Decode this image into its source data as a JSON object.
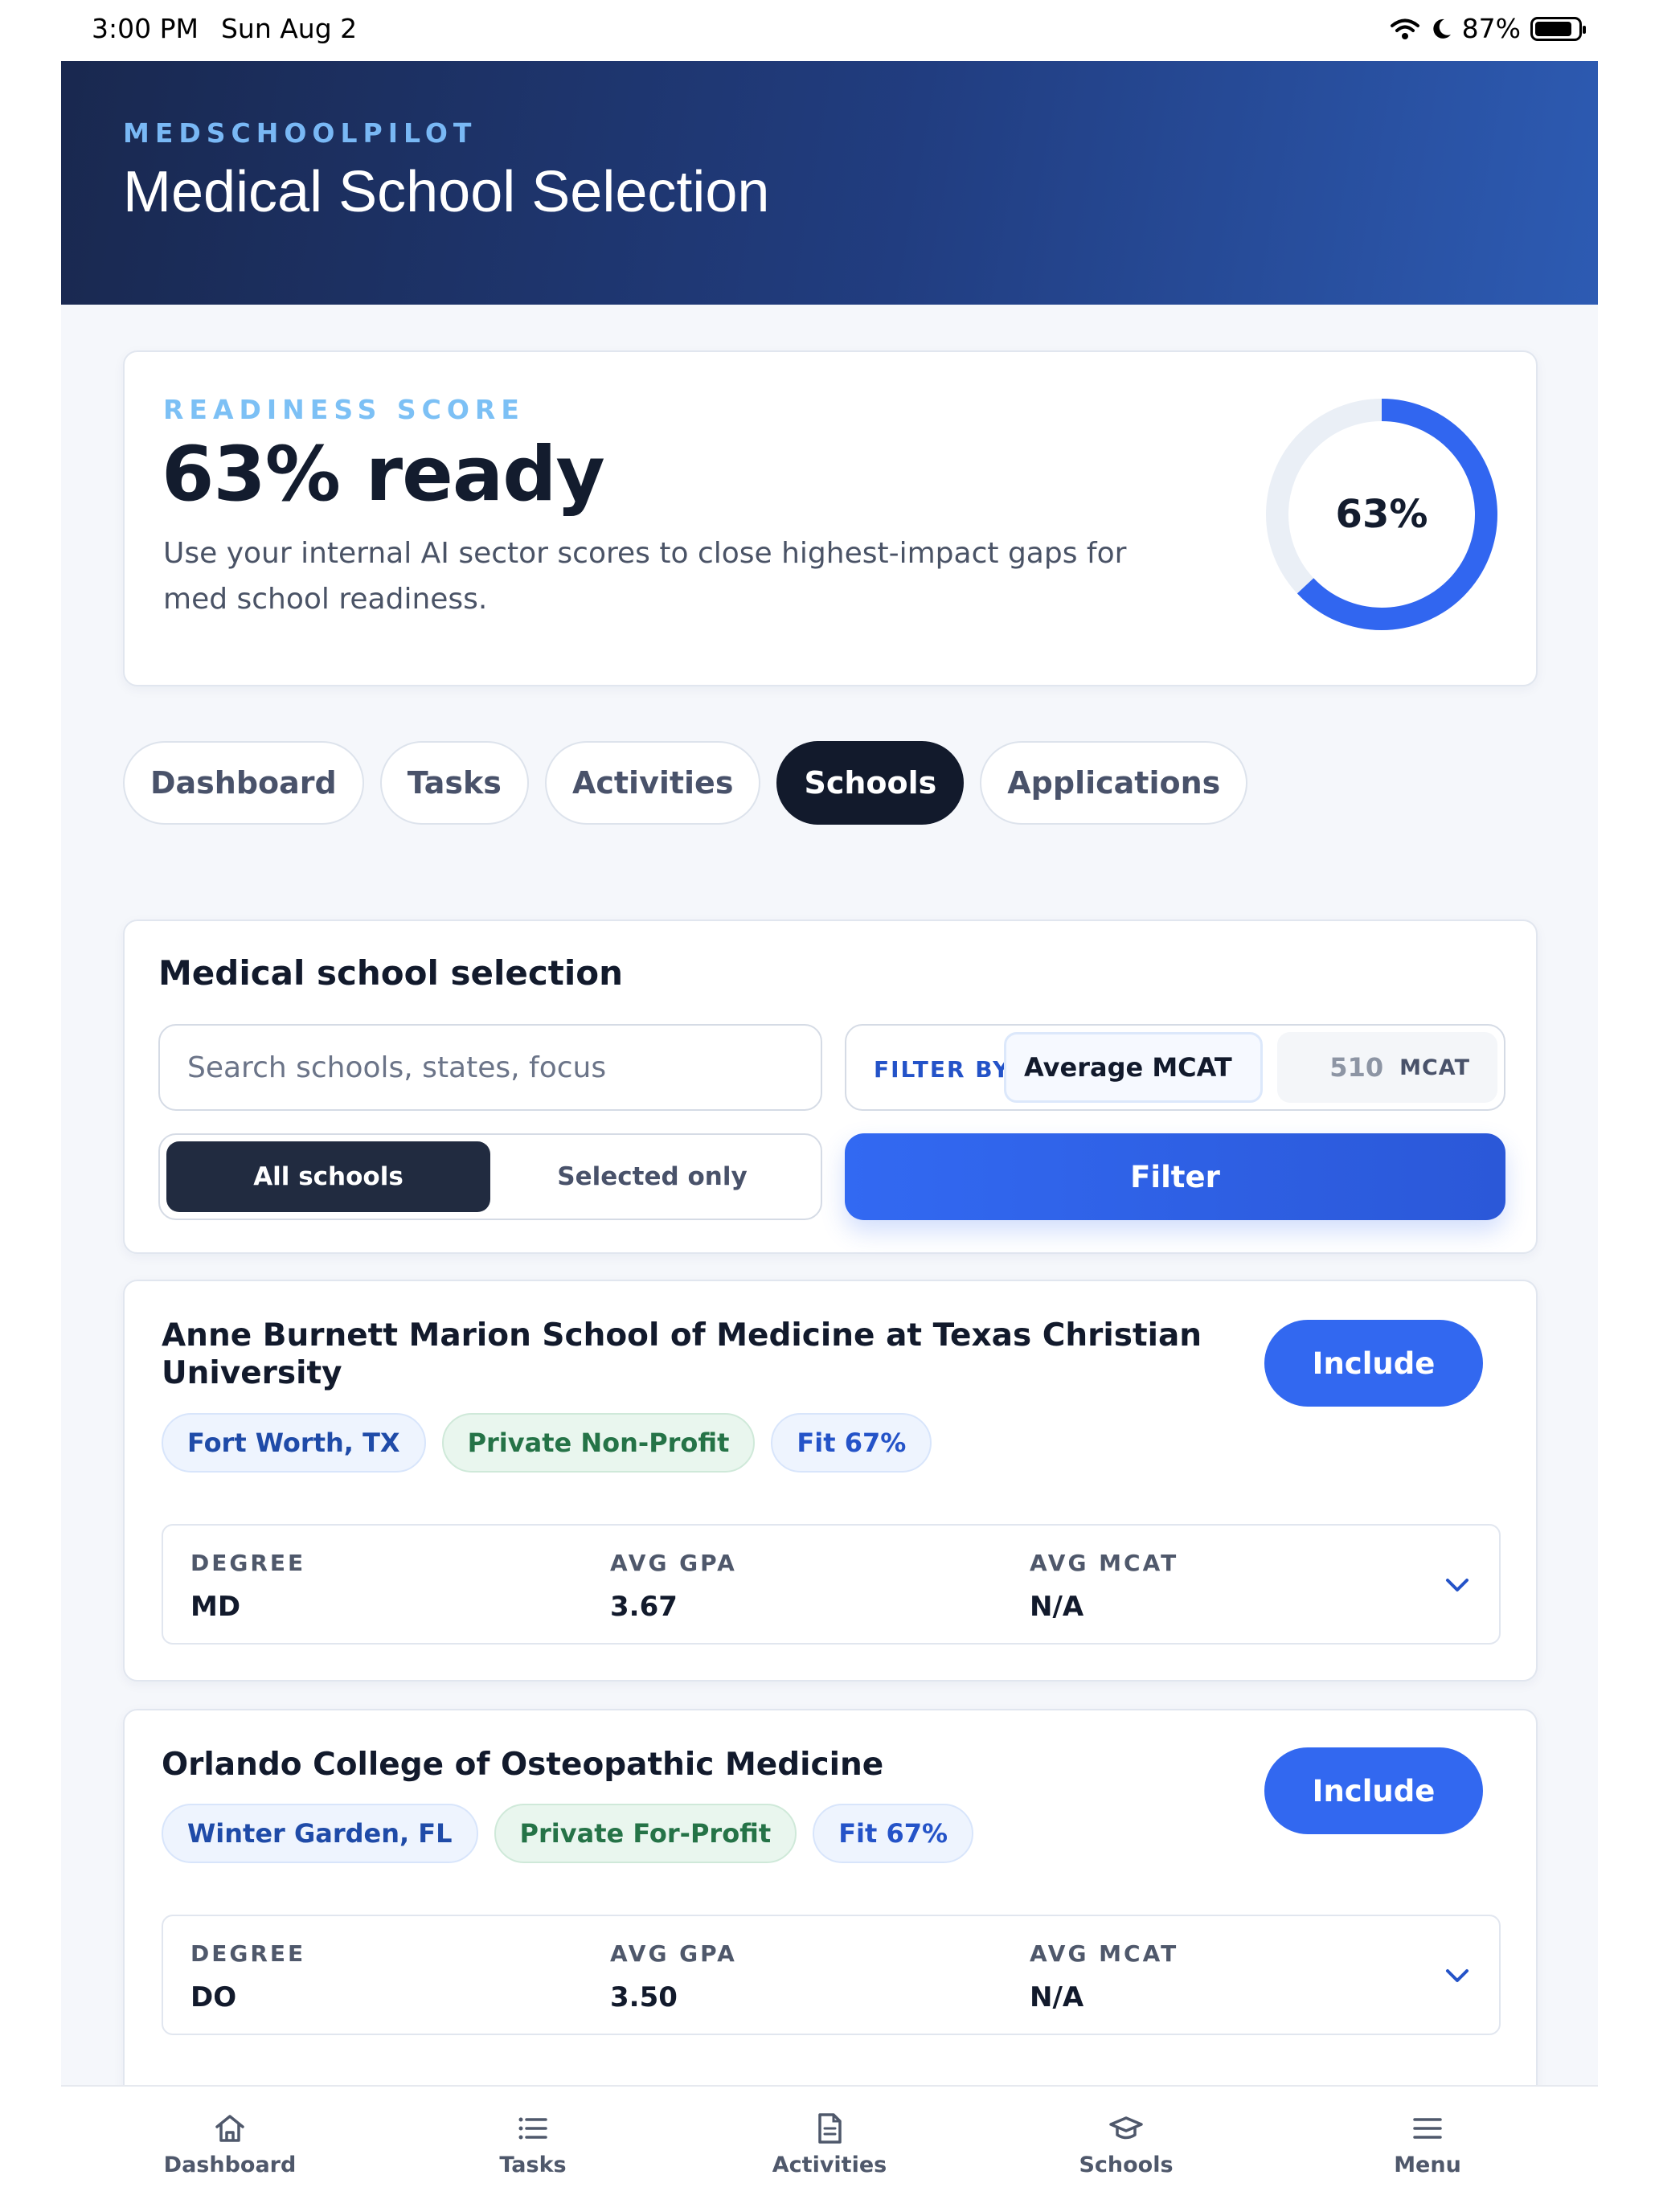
{
  "status_bar": {
    "time": "3:00 PM",
    "date": "Sun Aug 2",
    "battery": "87%",
    "battery_level": 0.87
  },
  "header": {
    "brand": "MEDSCHOOLPILOT",
    "title": "Medical School Selection"
  },
  "readiness": {
    "label": "READINESS SCORE",
    "title": "63% ready",
    "description": "Use your internal AI sector scores to close highest-impact gaps for med school readiness.",
    "ring_label": "63%",
    "progress": 0.63,
    "ring_color": "#3166f0",
    "ring_track_color": "#eaeff6"
  },
  "tabs": [
    {
      "label": "Dashboard",
      "active": false
    },
    {
      "label": "Tasks",
      "active": false
    },
    {
      "label": "Activities",
      "active": false
    },
    {
      "label": "Schools",
      "active": true
    },
    {
      "label": "Applications",
      "active": false
    }
  ],
  "selection": {
    "title": "Medical school selection",
    "search_placeholder": "Search schools, states, focus",
    "filter_by_label": "FILTER BY",
    "filter_field": "Average MCAT",
    "filter_value": "510",
    "filter_unit": "MCAT",
    "toggle_all": "All schools",
    "toggle_selected": "Selected only",
    "filter_button": "Filter"
  },
  "schools": [
    {
      "name": "Anne Burnett Marion School of Medicine at Texas Christian University",
      "location": "Fort Worth, TX",
      "type": "Private Non-Profit",
      "fit": "Fit 67%",
      "include_label": "Include",
      "degree_label": "DEGREE",
      "degree": "MD",
      "gpa_label": "AVG GPA",
      "gpa": "3.67",
      "mcat_label": "AVG MCAT",
      "mcat": "N/A"
    },
    {
      "name": "Orlando College of Osteopathic Medicine",
      "location": "Winter Garden, FL",
      "type": "Private For-Profit",
      "fit": "Fit 67%",
      "include_label": "Include",
      "degree_label": "DEGREE",
      "degree": "DO",
      "gpa_label": "AVG GPA",
      "gpa": "3.50",
      "mcat_label": "AVG MCAT",
      "mcat": "N/A"
    }
  ],
  "bottom_nav": [
    {
      "label": "Dashboard",
      "icon": "home-icon"
    },
    {
      "label": "Tasks",
      "icon": "list-icon"
    },
    {
      "label": "Activities",
      "icon": "document-icon"
    },
    {
      "label": "Schools",
      "icon": "graduation-cap-icon"
    },
    {
      "label": "Menu",
      "icon": "hamburger-menu-icon"
    }
  ]
}
